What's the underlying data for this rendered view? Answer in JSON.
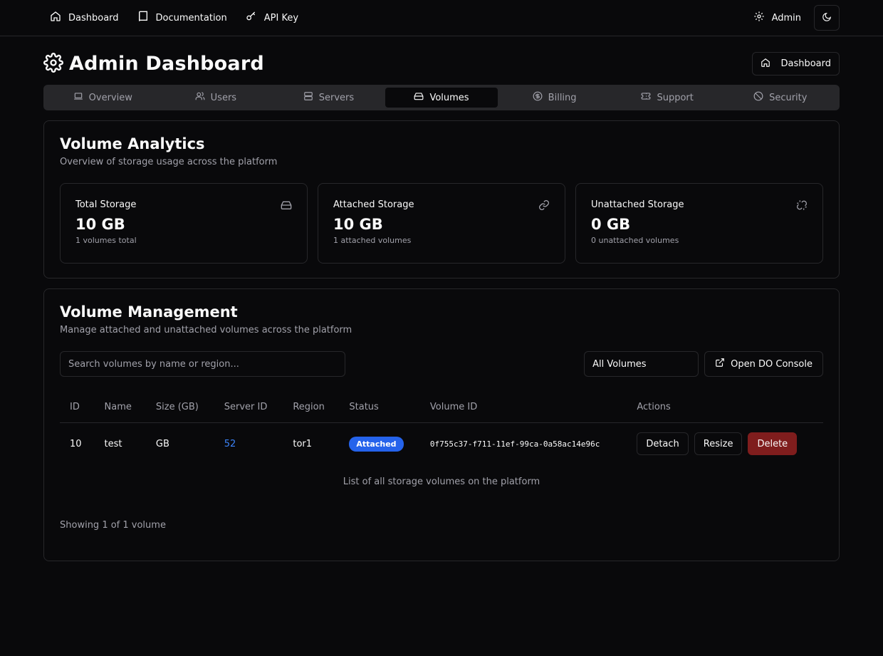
{
  "nav": {
    "dashboard": "Dashboard",
    "documentation": "Documentation",
    "api_key": "API Key",
    "admin": "Admin"
  },
  "header": {
    "title": "Admin Dashboard",
    "dashboard_button": "Dashboard"
  },
  "tabs": [
    {
      "label": "Overview",
      "icon": "laptop-icon"
    },
    {
      "label": "Users",
      "icon": "users-icon"
    },
    {
      "label": "Servers",
      "icon": "server-icon"
    },
    {
      "label": "Volumes",
      "icon": "hard-drive-icon",
      "active": true
    },
    {
      "label": "Billing",
      "icon": "dollar-icon"
    },
    {
      "label": "Support",
      "icon": "ticket-icon"
    },
    {
      "label": "Security",
      "icon": "ban-icon"
    }
  ],
  "analytics": {
    "title": "Volume Analytics",
    "subtitle": "Overview of storage usage across the platform",
    "stats": [
      {
        "label": "Total Storage",
        "value": "10 GB",
        "note": "1 volumes total",
        "icon": "hard-drive-icon"
      },
      {
        "label": "Attached Storage",
        "value": "10 GB",
        "note": "1 attached volumes",
        "icon": "link-icon"
      },
      {
        "label": "Unattached Storage",
        "value": "0 GB",
        "note": "0 unattached volumes",
        "icon": "unlink-icon"
      }
    ]
  },
  "management": {
    "title": "Volume Management",
    "subtitle": "Manage attached and unattached volumes across the platform",
    "search_placeholder": "Search volumes by name or region...",
    "filter_value": "All Volumes",
    "console_button": "Open DO Console",
    "columns": [
      "ID",
      "Name",
      "Size (GB)",
      "Server ID",
      "Region",
      "Status",
      "Volume ID",
      "Actions"
    ],
    "rows": [
      {
        "id": "10",
        "name": "test",
        "size": "GB",
        "server_id": "52",
        "region": "tor1",
        "status": "Attached",
        "volume_id": "0f755c37-f711-11ef-99ca-0a58ac14e96c",
        "actions": {
          "detach": "Detach",
          "resize": "Resize",
          "delete": "Delete"
        }
      }
    ],
    "caption": "List of all storage volumes on the platform",
    "showing": "Showing 1 of 1 volume"
  },
  "colors": {
    "background": "#09090b",
    "border": "#27272a",
    "link": "#3b82f6",
    "badge": "#2563eb",
    "delete": "#7f1d1d"
  }
}
